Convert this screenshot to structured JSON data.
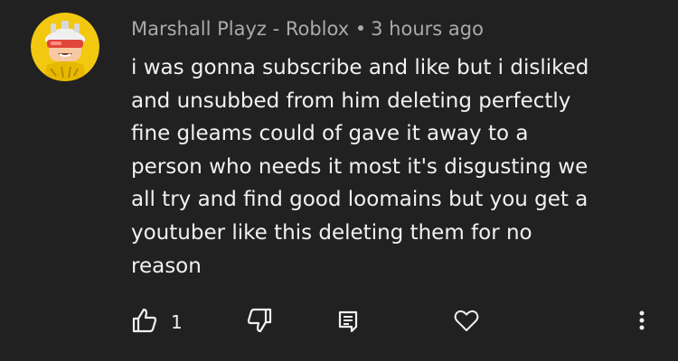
{
  "comment": {
    "author": "Marshall Playz - Roblox",
    "time": "3 hours ago",
    "text": "i was gonna subscribe and like but i disliked\nand unsubbed from him deleting perfectly\nfine gleams could of gave it away to a\nperson who needs it most it's disgusting we\nall try and find good loomains but you get a\nyoutuber like this deleting them for no\nreason",
    "like_count": "1"
  },
  "icons": {
    "like": "thumbs-up-icon",
    "dislike": "thumbs-down-icon",
    "reply": "reply-icon",
    "heart": "heart-icon",
    "menu": "more-vert-icon"
  },
  "colors": {
    "background": "#212121",
    "text": "#f1f1f1",
    "meta": "#aaaaaa",
    "avatar_bg": "#f2c811"
  }
}
